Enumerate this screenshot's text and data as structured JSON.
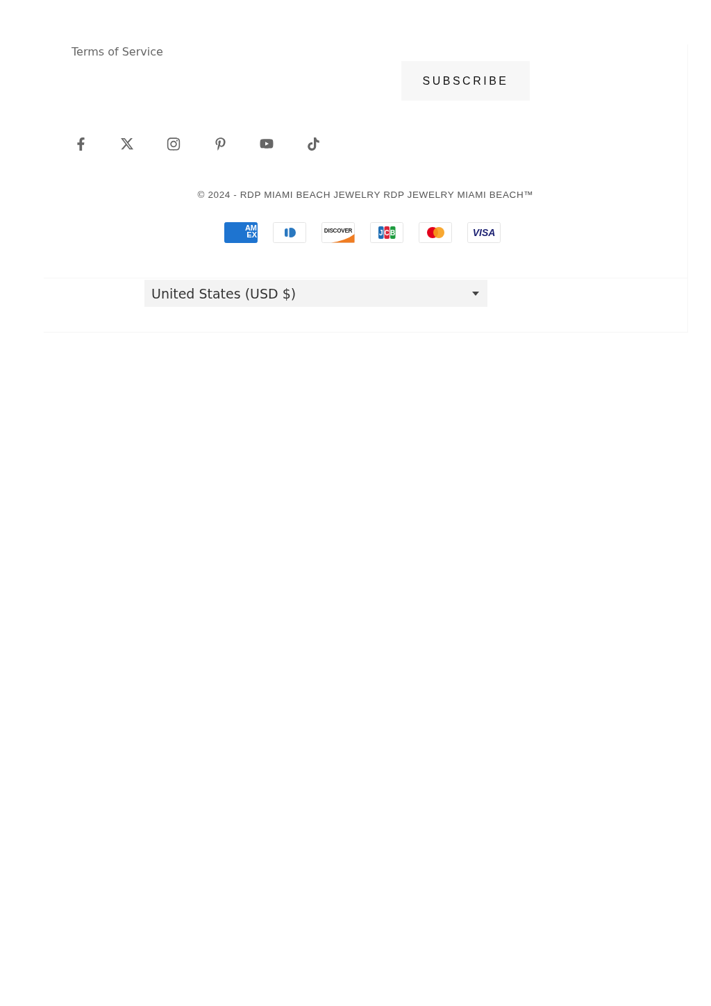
{
  "footer_links": [
    {
      "label": "Terms of Service"
    }
  ],
  "subscribe_button": {
    "label": "SUBSCRIBE"
  },
  "social_links": [
    {
      "kind": "facebook"
    },
    {
      "kind": "x"
    },
    {
      "kind": "instagram"
    },
    {
      "kind": "pinterest"
    },
    {
      "kind": "youtube"
    },
    {
      "kind": "tiktok"
    }
  ],
  "copyright": "© 2024 - RDP MIAMI BEACH JEWELRY RDP JEWELRY MIAMI BEACH™",
  "payment_methods": [
    {
      "kind": "amex",
      "lines": [
        "AM",
        "EX"
      ]
    },
    {
      "kind": "diners"
    },
    {
      "kind": "discover",
      "label": "DISCOVER"
    },
    {
      "kind": "jcb",
      "label": "JCB"
    },
    {
      "kind": "mastercard"
    },
    {
      "kind": "visa",
      "label": "VISA"
    }
  ],
  "currency_selector": {
    "value": "United States (USD $)"
  }
}
